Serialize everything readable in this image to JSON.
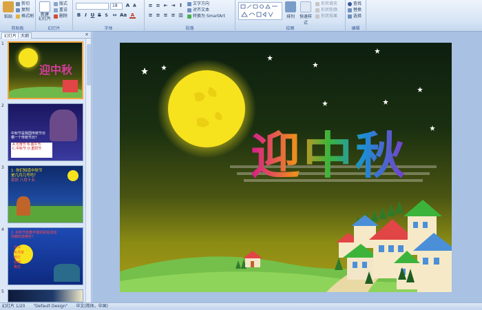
{
  "ribbon": {
    "clipboard": {
      "label": "剪贴板",
      "paste": "粘贴",
      "cut": "剪切",
      "copy": "复制",
      "format_painter": "格式刷"
    },
    "slides": {
      "label": "幻灯片",
      "new_slide": "新建\n幻灯片",
      "layout": "版式",
      "reset": "重设",
      "delete": "删除"
    },
    "font": {
      "label": "字体",
      "font_name": "",
      "font_size": "18"
    },
    "paragraph": {
      "label": "段落",
      "text_direction": "文字方向",
      "align_text": "对齐文本",
      "convert_smartart": "转换为 SmartArt"
    },
    "drawing": {
      "label": "绘图",
      "arrange": "排列",
      "quick_styles": "快速样式",
      "shape_fill": "形状填充",
      "shape_outline": "形状轮廓",
      "shape_effects": "形状效果"
    },
    "editing": {
      "label": "编辑",
      "find": "查找",
      "replace": "替换",
      "select": "选择"
    }
  },
  "panel": {
    "tab_slides": "幻灯片",
    "tab_outline": "大纲",
    "close": "×",
    "thumbnails": [
      {
        "num": "1",
        "title": "迎中秋"
      },
      {
        "num": "2",
        "lines": [
          "中秋节是我国传统节日",
          "哪一个传统节日？"
        ],
        "options": [
          "A.元宵节",
          "B.端午节",
          "C.中秋节",
          "D.重阳节"
        ]
      },
      {
        "num": "3",
        "lines": [
          "1. 你们知道中秋节",
          "是几月几号吗？",
          "农历 八月十五"
        ]
      },
      {
        "num": "4",
        "lines": [
          "2. 中秋节有着丰富的民俗活动",
          "你都知道哪些？"
        ],
        "options": [
          "赏月",
          "吃月饼",
          "放灯",
          "猜谜",
          "舞龙"
        ]
      },
      {
        "num": "5"
      }
    ]
  },
  "slide": {
    "title": "迎中秋"
  },
  "status": {
    "slide_indicator": "幻灯片 1/20",
    "theme": "\"Default Design\"",
    "language": "中文(简体，中国)"
  },
  "colors": {
    "moon": "#f7e21e",
    "sky_top": "#0d1f0f",
    "ground": "#74c04a",
    "title_letters": [
      "#d41c8c",
      "#f08c1e",
      "#1e8cd4",
      "#3cb43c",
      "#7c3cc8"
    ],
    "accent_selected": "#f5a43b"
  }
}
